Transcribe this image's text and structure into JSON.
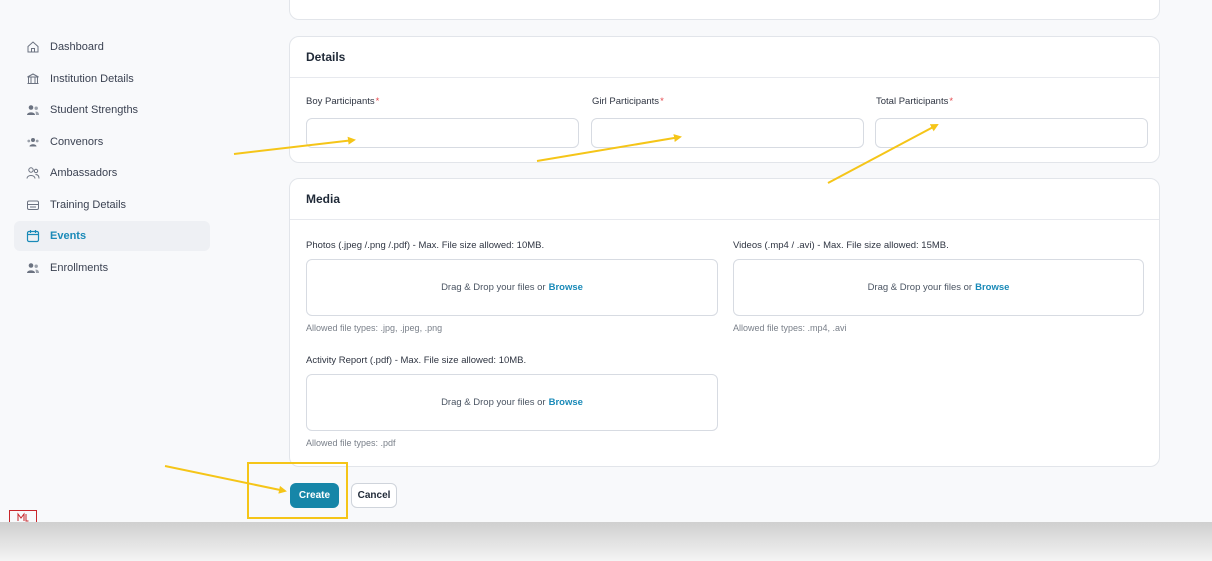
{
  "sidebar": {
    "items": [
      {
        "label": "Dashboard",
        "icon": "home-icon",
        "active": false
      },
      {
        "label": "Institution Details",
        "icon": "building-icon",
        "active": false
      },
      {
        "label": "Student Strengths",
        "icon": "users-icon",
        "active": false
      },
      {
        "label": "Convenors",
        "icon": "group-icon",
        "active": false
      },
      {
        "label": "Ambassadors",
        "icon": "people-outline-icon",
        "active": false
      },
      {
        "label": "Training Details",
        "icon": "training-icon",
        "active": false
      },
      {
        "label": "Events",
        "icon": "calendar-icon",
        "active": true
      },
      {
        "label": "Enrollments",
        "icon": "users-icon",
        "active": false
      }
    ]
  },
  "details": {
    "title": "Details",
    "boy_label": "Boy Participants",
    "girl_label": "Girl Participants",
    "total_label": "Total Participants",
    "required_mark": "*",
    "boy_value": "",
    "girl_value": "",
    "total_value": ""
  },
  "media": {
    "title": "Media",
    "photos_label": "Photos (.jpeg /.png /.pdf) - Max. File size allowed: 10MB.",
    "videos_label": "Videos (.mp4 / .avi) - Max. File size allowed: 15MB.",
    "report_label": "Activity Report (.pdf) - Max. File size allowed: 10MB.",
    "drop_text": "Drag & Drop your files or",
    "browse_text": "Browse",
    "photos_hint": "Allowed file types: .jpg, .jpeg, .png",
    "videos_hint": "Allowed file types: .mp4, .avi",
    "report_hint": "Allowed file types: .pdf"
  },
  "actions": {
    "create_label": "Create",
    "cancel_label": "Cancel"
  },
  "colors": {
    "accent": "#1686a8",
    "annotation": "#f5c518",
    "required": "#e5484d"
  }
}
